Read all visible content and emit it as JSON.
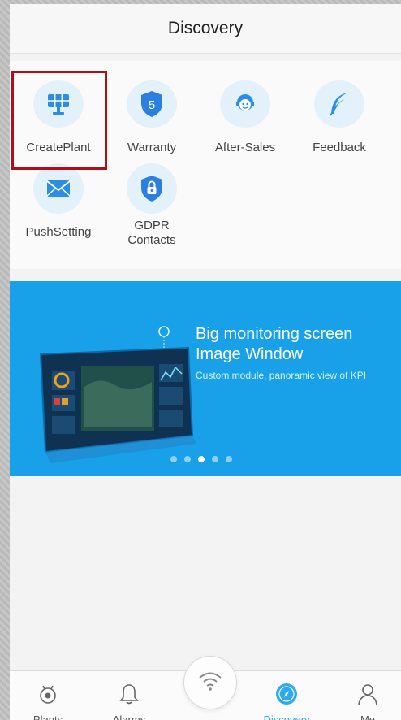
{
  "header": {
    "title": "Discovery"
  },
  "grid": {
    "items": [
      {
        "label": "CreatePlant",
        "icon": "solar-panel-icon"
      },
      {
        "label": "Warranty",
        "icon": "warranty-shield-icon",
        "badge": "5"
      },
      {
        "label": "After-Sales",
        "icon": "support-agent-icon"
      },
      {
        "label": "Feedback",
        "icon": "feather-icon"
      },
      {
        "label": "PushSetting",
        "icon": "mail-icon"
      },
      {
        "label": "GDPR\nContacts",
        "icon": "lock-shield-icon"
      }
    ]
  },
  "banner": {
    "title_line1": "Big monitoring screen",
    "title_line2": "Image Window",
    "subtitle": "Custom module, panoramic view of KPI",
    "dots": 5,
    "active_dot": 2,
    "color": "#18a1e8"
  },
  "tabs": [
    {
      "label": "Plants",
      "icon": "plant-icon"
    },
    {
      "label": "Alarms",
      "icon": "bell-icon"
    },
    {
      "label": "Discovery",
      "icon": "compass-icon",
      "active": true
    },
    {
      "label": "Me",
      "icon": "user-icon"
    }
  ],
  "center_button": {
    "icon": "wifi-icon"
  },
  "colors": {
    "accent": "#2eaaf2",
    "highlight": "#b10e17",
    "icon_bg": "#e3f1fb"
  }
}
